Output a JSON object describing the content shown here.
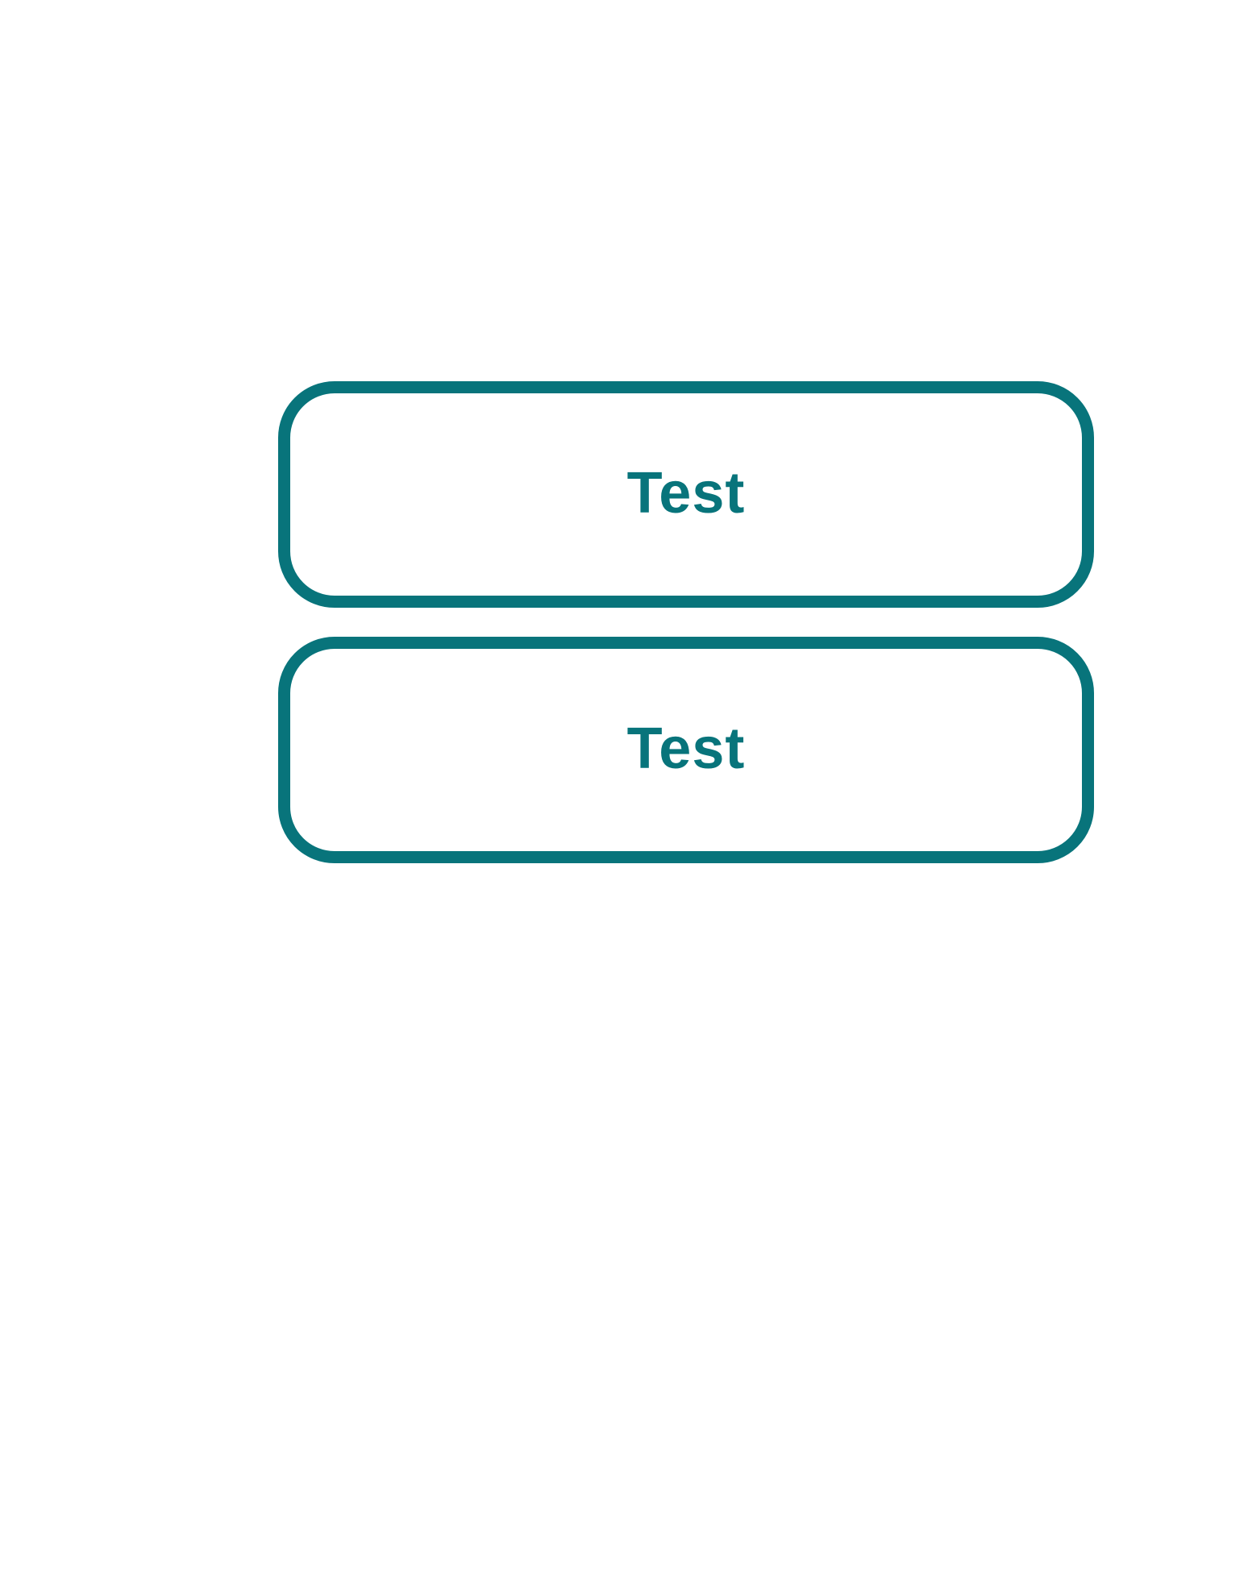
{
  "buttons": [
    {
      "label": "Test"
    },
    {
      "label": "Test"
    }
  ],
  "colors": {
    "accent": "#08747b",
    "background": "#ffffff"
  }
}
